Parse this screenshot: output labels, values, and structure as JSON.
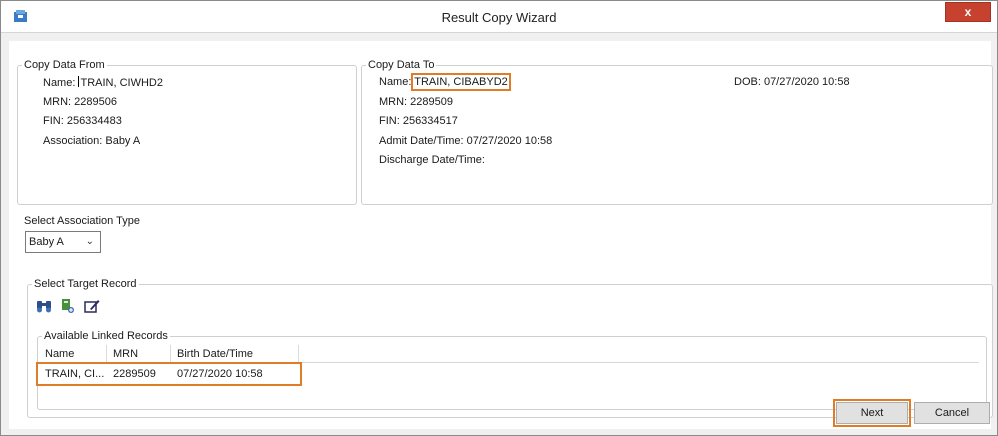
{
  "window": {
    "title": "Result Copy Wizard",
    "close_label": "x",
    "accent": "#e07b28",
    "close_color": "#c7412f"
  },
  "copy_from": {
    "legend": "Copy Data From",
    "name_label": "Name:",
    "name_value": "TRAIN, CIWHD2",
    "mrn": "MRN: 2289506",
    "fin": "FIN: 256334483",
    "association": "Association: Baby A"
  },
  "copy_to": {
    "legend": "Copy Data To",
    "name_label": "Name:",
    "name_value": "TRAIN, CIBABYD2",
    "dob": "DOB: 07/27/2020 10:58",
    "mrn": "MRN: 2289509",
    "fin": "FIN: 256334517",
    "admit": "Admit Date/Time: 07/27/2020 10:58",
    "discharge": "Discharge Date/Time:"
  },
  "association": {
    "label": "Select Association Type",
    "selected": "Baby A"
  },
  "target": {
    "legend": "Select Target Record",
    "toolbar_icons": [
      "binoculars-icon",
      "add-record-icon",
      "edit-icon"
    ]
  },
  "linked": {
    "legend": "Available Linked Records",
    "columns": [
      "Name",
      "MRN",
      "Birth Date/Time"
    ],
    "rows": [
      {
        "name": "TRAIN, CI...",
        "mrn": "2289509",
        "birth": "07/27/2020 10:58"
      }
    ]
  },
  "buttons": {
    "next": "Next",
    "cancel": "Cancel"
  }
}
